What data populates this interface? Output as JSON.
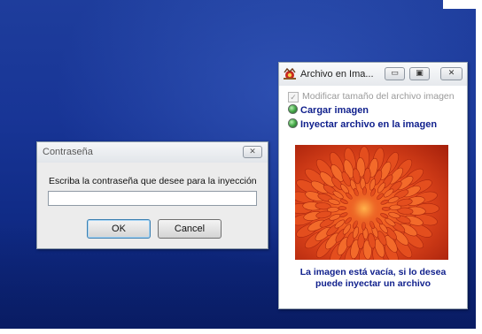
{
  "password_dialog": {
    "title": "Contraseña",
    "close_glyph": "✕",
    "prompt": "Escriba la contraseña que desee para la inyección",
    "input_value": "",
    "ok_label": "OK",
    "cancel_label": "Cancel"
  },
  "image_window": {
    "title": "Archivo en Ima...",
    "minimize_glyph": "▭",
    "maximize_glyph": "▣",
    "close_glyph": "✕",
    "options": {
      "resize_label": "Modificar tamaño del archivo imagen",
      "resize_checked": true,
      "load_image_label": "Cargar imagen",
      "inject_file_label": "Inyectar archivo en la imagen"
    },
    "status_line1": "La imagen está vacía, si lo desea",
    "status_line2": "puede inyectar un archivo"
  },
  "colors": {
    "desktop": "#183596",
    "link_text": "#0f1f8c",
    "flower": "#e2471c"
  },
  "icons": [
    "close-icon",
    "minimize-icon",
    "maximize-icon",
    "app-icon",
    "radio-icon",
    "checkbox-icon"
  ]
}
